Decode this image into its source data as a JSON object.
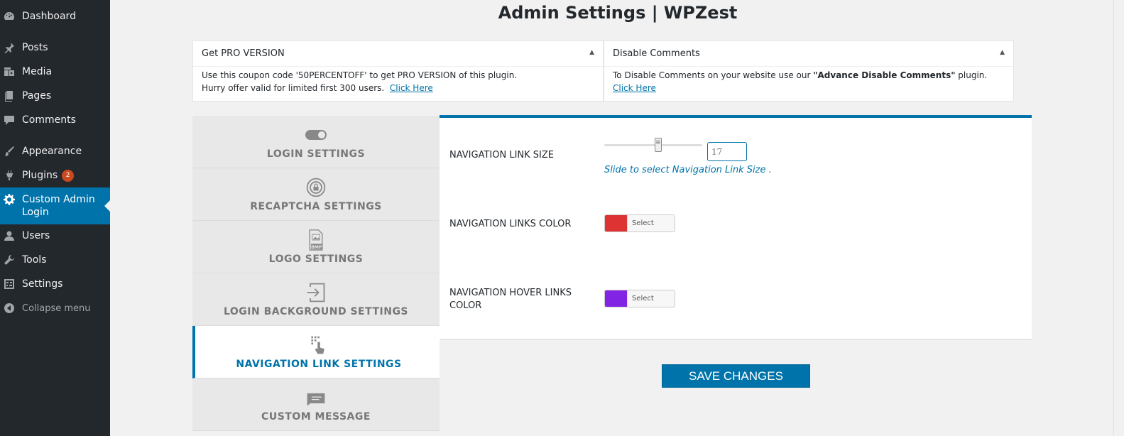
{
  "sidebar": {
    "items": [
      {
        "label": "Dashboard",
        "icon": "dashboard-icon"
      },
      {
        "label": "Posts",
        "icon": "pin-icon"
      },
      {
        "label": "Media",
        "icon": "media-icon"
      },
      {
        "label": "Pages",
        "icon": "pages-icon"
      },
      {
        "label": "Comments",
        "icon": "comment-icon"
      },
      {
        "label": "Appearance",
        "icon": "brush-icon"
      },
      {
        "label": "Plugins",
        "icon": "plugin-icon",
        "badge": "2"
      },
      {
        "label": "Custom Admin Login",
        "icon": "gear-icon"
      },
      {
        "label": "Users",
        "icon": "user-icon"
      },
      {
        "label": "Tools",
        "icon": "wrench-icon"
      },
      {
        "label": "Settings",
        "icon": "settings-sliders-icon"
      },
      {
        "label": "Collapse menu",
        "icon": "collapse-icon"
      }
    ]
  },
  "page_title": "Admin Settings | WPZest",
  "notices": {
    "pro": {
      "title": "Get PRO VERSION",
      "line1_pre": "Use this coupon code '",
      "coupon": "50PERCENTOFF",
      "line1_mid": "' to get ",
      "pro_version": "PRO VERSION",
      "line1_post": " of this plugin.",
      "line2": "Hurry offer valid for limited first 300 users.",
      "link": "Click Here"
    },
    "disable": {
      "title": "Disable Comments",
      "line1_pre": "To Disable Comments on your website use our ",
      "plugin_name": "\"Advance Disable Comments\"",
      "line1_post": " plugin.",
      "link": "Click Here"
    }
  },
  "tabs": [
    {
      "label": "LOGIN SETTINGS",
      "icon": "toggle-icon"
    },
    {
      "label": "RECAPTCHA SETTINGS",
      "icon": "lock-circle-icon"
    },
    {
      "label": "LOGO SETTINGS",
      "icon": "bmp-file-icon",
      "icon_text": "BMP"
    },
    {
      "label": "LOGIN BACKGROUND SETTINGS",
      "icon": "sign-in-icon"
    },
    {
      "label": "NAVIGATION LINK SETTINGS",
      "icon": "touch-grid-icon",
      "active": true
    },
    {
      "label": "CUSTOM MESSAGE",
      "icon": "message-icon"
    }
  ],
  "settings": {
    "link_size": {
      "label": "NAVIGATION LINK SIZE",
      "value": "17",
      "slider_fraction": 0.55,
      "hint": "Slide to select Navigation Link Size ."
    },
    "links_color": {
      "label": "NAVIGATION LINKS COLOR",
      "color": "#dd3333",
      "button": "Select Color"
    },
    "hover_color": {
      "label_line1": "NAVIGATION HOVER LINKS",
      "label_line2": "COLOR",
      "color": "#8224e3",
      "button": "Select Color"
    }
  },
  "save_label": "SAVE CHANGES",
  "colors": {
    "accent": "#0073aa",
    "sidebar_bg": "#23282d",
    "badge": "#ca4a1f"
  }
}
